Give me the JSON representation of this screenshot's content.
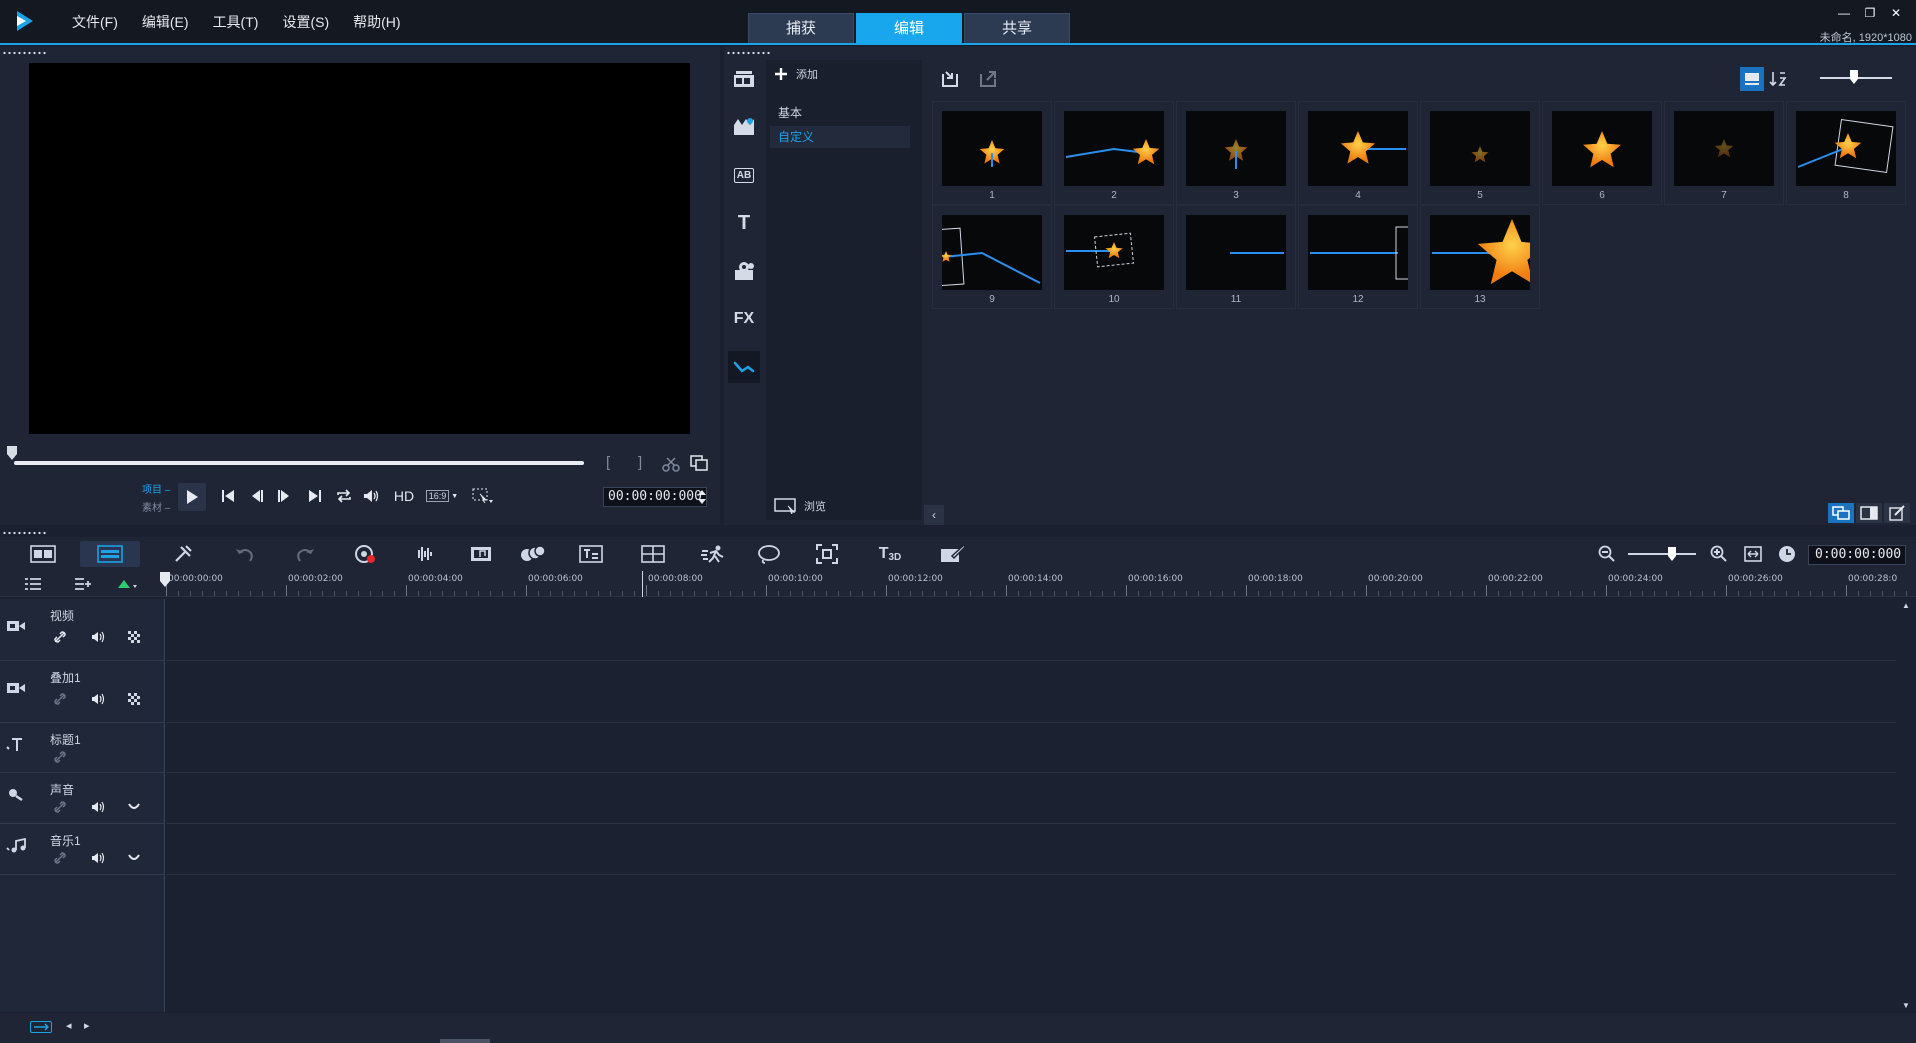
{
  "app": {
    "menu": [
      "文件(F)",
      "编辑(E)",
      "工具(T)",
      "设置(S)",
      "帮助(H)"
    ],
    "mode_tabs": [
      {
        "label": "捕获",
        "active": false
      },
      {
        "label": "编辑",
        "active": true
      },
      {
        "label": "共享",
        "active": false
      }
    ],
    "window_controls": [
      "—",
      "❐",
      "✕"
    ],
    "project_info": "未命名, 1920*1080",
    "accent_color": "#1aa3e8"
  },
  "preview": {
    "project_mode_label": "项目",
    "clip_mode_label": "素材",
    "hd_label": "HD",
    "aspect_label": "16:9",
    "timecode": "00:00:00:000",
    "mark_in": "[",
    "mark_out": "]"
  },
  "library": {
    "categories": [
      {
        "icon": "media-icon",
        "active": false
      },
      {
        "icon": "instant-project-icon",
        "active": false
      },
      {
        "icon": "transition-icon",
        "label": "AB",
        "active": false
      },
      {
        "icon": "title-icon",
        "label": "T",
        "active": false
      },
      {
        "icon": "graphics-icon",
        "active": false
      },
      {
        "icon": "filter-icon",
        "label": "FX",
        "active": false
      },
      {
        "icon": "path-icon",
        "active": true
      }
    ],
    "add_label": "添加",
    "folders": [
      {
        "label": "基本",
        "active": false
      },
      {
        "label": "自定义",
        "active": true
      }
    ],
    "browse_label": "浏览",
    "thumbnails": [
      "1",
      "2",
      "3",
      "4",
      "5",
      "6",
      "7",
      "8",
      "9",
      "10",
      "11",
      "12",
      "13"
    ]
  },
  "timeline": {
    "timecode": "0:00:00:000",
    "ruler_labels": [
      "00:00:00:00",
      "00:00:02:00",
      "00:00:04:00",
      "00:00:06:00",
      "00:00:08:00",
      "00:00:10:00",
      "00:00:12:00",
      "00:00:14:00",
      "00:00:16:00",
      "00:00:18:00",
      "00:00:20:00",
      "00:00:22:00",
      "00:00:24:00",
      "00:00:26:00",
      "00:00:28:0"
    ],
    "tracks": [
      {
        "name": "视频",
        "icon": "video-track-icon"
      },
      {
        "name": "叠加1",
        "icon": "overlay-track-icon"
      },
      {
        "name": "标题1",
        "icon": "title-track-icon"
      },
      {
        "name": "声音",
        "icon": "voice-track-icon"
      },
      {
        "name": "音乐1",
        "icon": "music-track-icon"
      }
    ]
  }
}
